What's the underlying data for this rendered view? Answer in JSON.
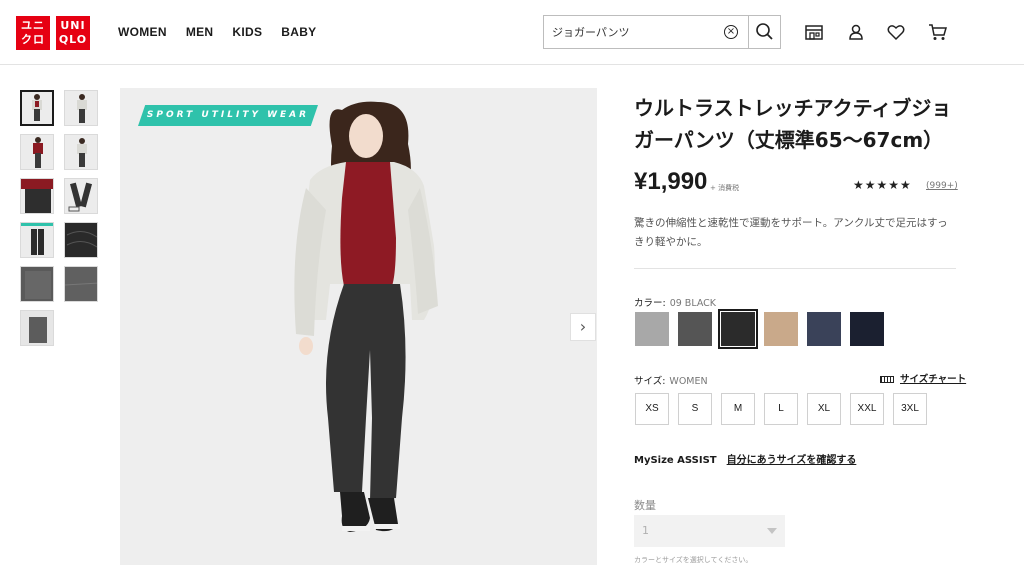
{
  "brand": {
    "logo_top": "ユニクロ",
    "logo_left": "ユニ",
    "logo_left2": "クロ",
    "logo_right": "UNI",
    "logo_right2": "QLO",
    "red": "#e60012"
  },
  "nav": [
    "WOMEN",
    "MEN",
    "KIDS",
    "BABY"
  ],
  "search": {
    "value": "ジョガーパンツ"
  },
  "header_icons": [
    "store-icon",
    "account-icon",
    "heart-icon",
    "cart-icon"
  ],
  "hero": {
    "badge": "SPORT UTILITY WEAR",
    "next_label": "›"
  },
  "product": {
    "title": "ウルトラストレッチアクティブジョガーパンツ（丈標準65〜67cm）",
    "price": "¥1,990",
    "tax": "+ 消費税",
    "rating_stars": "★★★★★",
    "reviews": "(999+)",
    "description": "驚きの伸縮性と速乾性で運動をサポート。アンクル丈で足元はすっきり軽やかに。"
  },
  "color": {
    "label": "カラー:",
    "selected": "09 BLACK",
    "swatches": [
      {
        "name": "light-gray",
        "hex": "#a8a8a8"
      },
      {
        "name": "dark-gray",
        "hex": "#555555"
      },
      {
        "name": "black",
        "hex": "#2b2b2b"
      },
      {
        "name": "beige",
        "hex": "#c9a98a"
      },
      {
        "name": "navy-heather",
        "hex": "#3a4259"
      },
      {
        "name": "navy",
        "hex": "#1b2030"
      }
    ]
  },
  "size": {
    "label": "サイズ:",
    "selected": "WOMEN",
    "chart_label": "サイズチャート",
    "options": [
      "XS",
      "S",
      "M",
      "L",
      "XL",
      "XXL",
      "3XL"
    ]
  },
  "mysize": {
    "label": "MySize ASSIST",
    "link": "自分にあうサイズを確認する"
  },
  "quantity": {
    "label": "数量",
    "value": "1",
    "note": "カラーとサイズを選択してください。"
  }
}
